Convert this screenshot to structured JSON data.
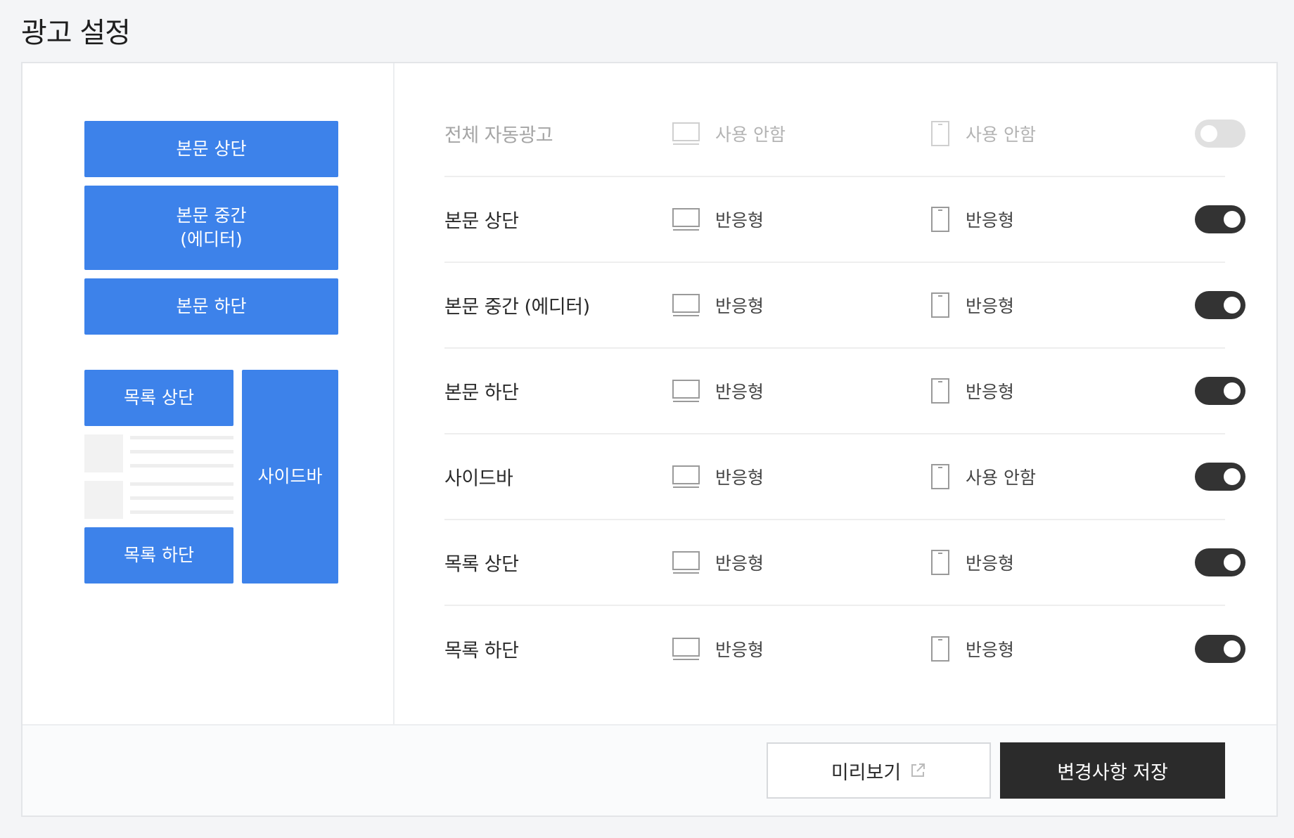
{
  "page": {
    "title": "광고 설정"
  },
  "layout_preview": {
    "blocks": [
      {
        "label": "본문 상단"
      },
      {
        "label": "본문 중간\n(에디터)"
      },
      {
        "label": "본문 하단"
      },
      {
        "label": "목록 상단"
      },
      {
        "label": "사이드바"
      },
      {
        "label": "목록 하단"
      }
    ]
  },
  "rows": [
    {
      "label": "전체 자동광고",
      "pc": "사용 안함",
      "mobile": "사용 안함",
      "enabled": false
    },
    {
      "label": "본문 상단",
      "pc": "반응형",
      "mobile": "반응형",
      "enabled": true
    },
    {
      "label": "본문 중간 (에디터)",
      "pc": "반응형",
      "mobile": "반응형",
      "enabled": true
    },
    {
      "label": "본문 하단",
      "pc": "반응형",
      "mobile": "반응형",
      "enabled": true
    },
    {
      "label": "사이드바",
      "pc": "반응형",
      "mobile": "사용 안함",
      "enabled": true
    },
    {
      "label": "목록 상단",
      "pc": "반응형",
      "mobile": "반응형",
      "enabled": true
    },
    {
      "label": "목록 하단",
      "pc": "반응형",
      "mobile": "반응형",
      "enabled": true
    }
  ],
  "icons": {
    "pc": "desktop-icon",
    "mobile": "mobile-icon",
    "preview": "external-link-icon"
  },
  "footer": {
    "preview_label": "미리보기",
    "save_label": "변경사항 저장"
  },
  "colors": {
    "accent": "#3d82ea",
    "dark": "#2b2b2b",
    "toggle_off": "#e0e0e0"
  }
}
